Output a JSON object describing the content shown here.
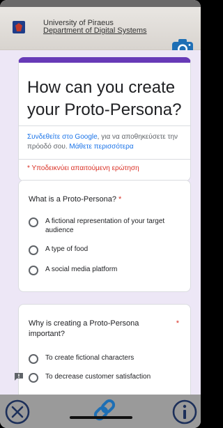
{
  "top_strip": {
    "text": ""
  },
  "university": {
    "line1": "University of Piraeus",
    "line2": "Department of Digital Systems"
  },
  "form": {
    "title": "How can you create your Proto-Persona?",
    "signin_link": "Συνδεθείτε στο Google",
    "signin_text": ", για να αποθηκεύσετε την πρόοδό σου.",
    "learn_more": "Μάθετε περισσότερα",
    "required_note": "* Υποδεικνύει απαιτούμενη ερώτηση"
  },
  "questions": [
    {
      "title": "What is a Proto-Persona?",
      "required": "*",
      "options": [
        "A fictional representation of your target audience",
        "A type of food",
        "A social media platform"
      ]
    },
    {
      "title": "Why is creating a Proto-Persona important?",
      "required": "*",
      "options": [
        "To create fictional characters",
        "To decrease customer satisfaction"
      ]
    }
  ],
  "icons": {
    "camera": "camera-icon",
    "close": "close-circle-icon",
    "link": "link-icon",
    "info": "info-circle-icon",
    "feedback": "feedback-icon"
  },
  "colors": {
    "accent": "#673ab7",
    "link": "#1a73e8",
    "required": "#d93025",
    "camera": "#1e6fb5"
  }
}
